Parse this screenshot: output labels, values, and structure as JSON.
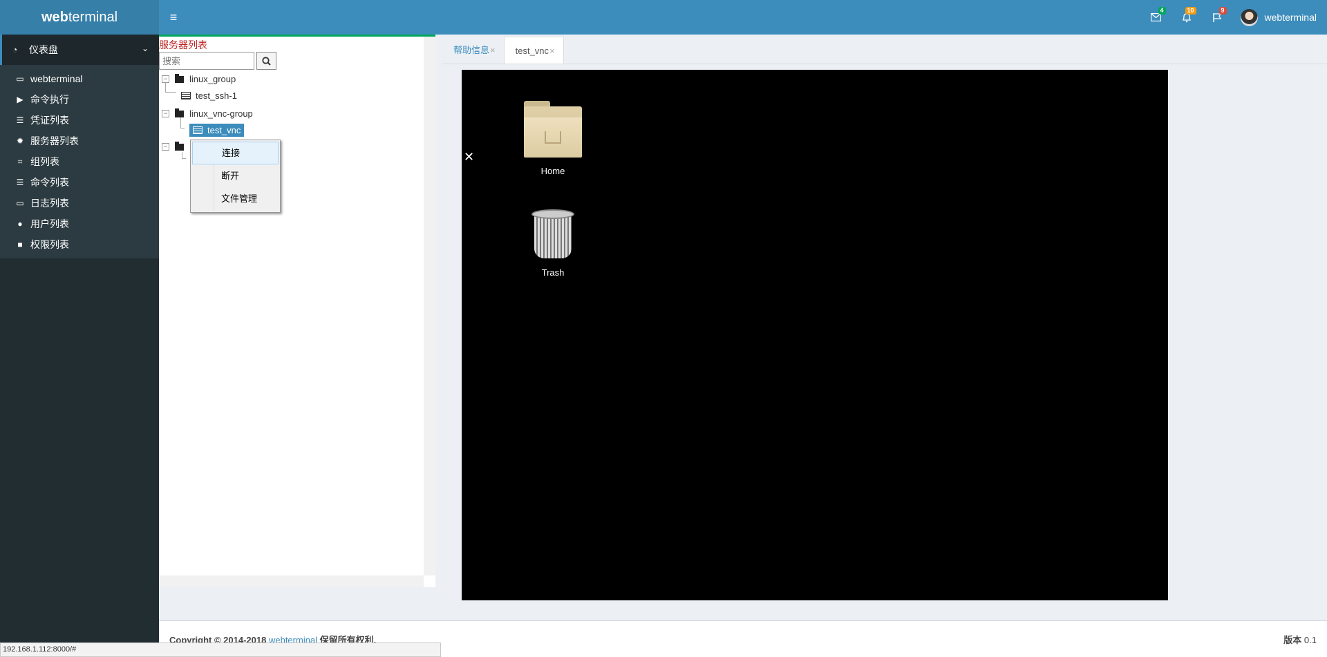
{
  "header": {
    "logo_bold": "web",
    "logo_light": "terminal",
    "toggle_icon": "hamburger-icon",
    "badges": [
      {
        "icon": "envelope-icon",
        "count": "4",
        "color": "#00a65a"
      },
      {
        "icon": "bell-icon",
        "count": "10",
        "color": "#f39c12"
      },
      {
        "icon": "flag-icon",
        "count": "9",
        "color": "#dd4b39"
      }
    ],
    "user_name": "webterminal"
  },
  "sidebar": {
    "header_label": "仪表盘",
    "items": [
      {
        "label": "webterminal",
        "icon": "laptop-icon"
      },
      {
        "label": "命令执行",
        "icon": "play-icon"
      },
      {
        "label": "凭证列表",
        "icon": "list-ol-icon"
      },
      {
        "label": "服务器列表",
        "icon": "gear-icon"
      },
      {
        "label": "组列表",
        "icon": "crop-icon"
      },
      {
        "label": "命令列表",
        "icon": "list-icon"
      },
      {
        "label": "日志列表",
        "icon": "monitor-icon"
      },
      {
        "label": "用户列表",
        "icon": "user-icon"
      },
      {
        "label": "权限列表",
        "icon": "lock-icon"
      }
    ]
  },
  "tree": {
    "title": "服务器列表",
    "search_placeholder": "搜索",
    "groups": [
      {
        "label": "linux_group",
        "children": [
          "test_ssh-1"
        ]
      },
      {
        "label": "linux_vnc-group",
        "children": [
          "test_vnc"
        ]
      }
    ]
  },
  "context_menu": {
    "items": [
      "连接",
      "断开",
      "文件管理"
    ]
  },
  "tabs": [
    {
      "label": "帮助信息",
      "active": false
    },
    {
      "label": "test_vnc",
      "active": true
    }
  ],
  "tab_close": "×",
  "vnc": {
    "icons": [
      {
        "label": "Home"
      },
      {
        "label": "Trash"
      }
    ]
  },
  "footer": {
    "copyright_prefix": "Copyright © 2014-2018 ",
    "copyright_link": "webterminal",
    "copyright_suffix": " 保留所有权利.",
    "version_label": "版本",
    "version_value": "0.1"
  },
  "statusbar": {
    "url": "192.168.1.112:8000/#"
  }
}
